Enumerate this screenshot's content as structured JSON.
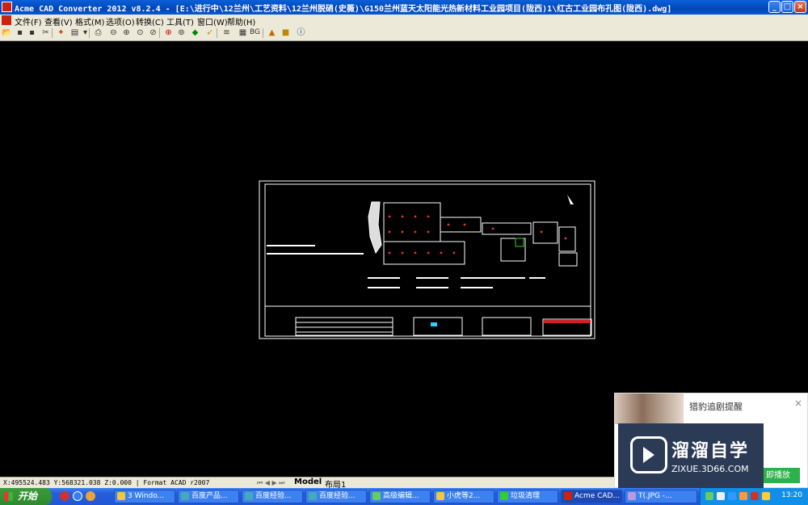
{
  "window": {
    "title": "Acme CAD Converter 2012 v8.2.4 - [E:\\进行中\\12兰州\\工艺资料\\12兰州脱硝(史薇)\\G150兰州蓝天太阳能光热新材料工业园项目(陇西)1\\红古工业园布孔图(陇西).dwg]",
    "minimize": "_",
    "maximize": "□",
    "close": "×"
  },
  "menu": {
    "items": [
      "文件(F)",
      "查看(V)",
      "格式(M)",
      "选项(O)",
      "转换(C)",
      "工具(T)",
      "窗口(W)",
      "帮助(H)"
    ]
  },
  "toolbar": {
    "icons": [
      "open-icon",
      "save-icon",
      "save-as-icon",
      "cut-icon",
      "convert-icon",
      "print-icon",
      "zoom-out-icon",
      "zoom-in-icon",
      "zoom-window-icon",
      "zoom-realtime-icon",
      "zoom-extents-icon",
      "pan-icon",
      "hide-icon",
      "layers-icon",
      "bg-color-icon",
      "bg-label-icon",
      "measure-icon",
      "markup-icon",
      "about-icon"
    ],
    "bg_label": "BG"
  },
  "status": {
    "coords": "X:495524.483 Y:568321.038 Z:0.000",
    "format": "Format ACAD r2007",
    "tab_model": "Model",
    "tab_layout": "布局1"
  },
  "taskbar": {
    "start_label": "开始",
    "tasks": [
      {
        "label": "3 Windo..."
      },
      {
        "label": "百度产品..."
      },
      {
        "label": "百度经验..."
      },
      {
        "label": "百度经验..."
      },
      {
        "label": "高级编辑..."
      },
      {
        "label": "小虎等2..."
      },
      {
        "label": "垃圾清理"
      },
      {
        "label": "Acme CAD..."
      },
      {
        "label": "T(.JPG -..."
      }
    ],
    "clock": "13:20"
  },
  "popup": {
    "title": "猎豹追剧提醒",
    "close": "×",
    "button": "即播放"
  },
  "watermark": {
    "title": "溜溜自学",
    "url": "ZIXUE.3D66.COM"
  },
  "colors": {
    "title_bar": "#0a5fd8",
    "menu_bg": "#ece9d8",
    "canvas_bg": "#000000",
    "taskbar": "#245edb",
    "start": "#3c9a3c"
  }
}
